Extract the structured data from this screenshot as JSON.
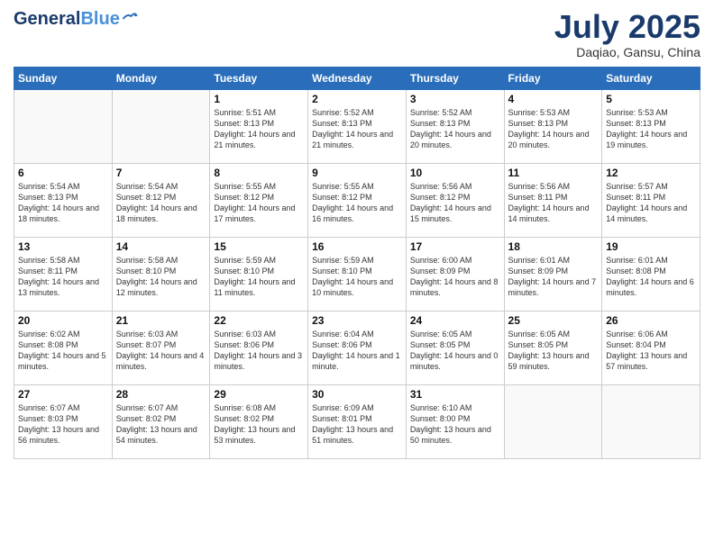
{
  "header": {
    "logo_line1": "General",
    "logo_line2": "Blue",
    "month_title": "July 2025",
    "subtitle": "Daqiao, Gansu, China"
  },
  "weekdays": [
    "Sunday",
    "Monday",
    "Tuesday",
    "Wednesday",
    "Thursday",
    "Friday",
    "Saturday"
  ],
  "weeks": [
    [
      {
        "day": "",
        "info": ""
      },
      {
        "day": "",
        "info": ""
      },
      {
        "day": "1",
        "info": "Sunrise: 5:51 AM\nSunset: 8:13 PM\nDaylight: 14 hours and 21 minutes."
      },
      {
        "day": "2",
        "info": "Sunrise: 5:52 AM\nSunset: 8:13 PM\nDaylight: 14 hours and 21 minutes."
      },
      {
        "day": "3",
        "info": "Sunrise: 5:52 AM\nSunset: 8:13 PM\nDaylight: 14 hours and 20 minutes."
      },
      {
        "day": "4",
        "info": "Sunrise: 5:53 AM\nSunset: 8:13 PM\nDaylight: 14 hours and 20 minutes."
      },
      {
        "day": "5",
        "info": "Sunrise: 5:53 AM\nSunset: 8:13 PM\nDaylight: 14 hours and 19 minutes."
      }
    ],
    [
      {
        "day": "6",
        "info": "Sunrise: 5:54 AM\nSunset: 8:13 PM\nDaylight: 14 hours and 18 minutes."
      },
      {
        "day": "7",
        "info": "Sunrise: 5:54 AM\nSunset: 8:12 PM\nDaylight: 14 hours and 18 minutes."
      },
      {
        "day": "8",
        "info": "Sunrise: 5:55 AM\nSunset: 8:12 PM\nDaylight: 14 hours and 17 minutes."
      },
      {
        "day": "9",
        "info": "Sunrise: 5:55 AM\nSunset: 8:12 PM\nDaylight: 14 hours and 16 minutes."
      },
      {
        "day": "10",
        "info": "Sunrise: 5:56 AM\nSunset: 8:12 PM\nDaylight: 14 hours and 15 minutes."
      },
      {
        "day": "11",
        "info": "Sunrise: 5:56 AM\nSunset: 8:11 PM\nDaylight: 14 hours and 14 minutes."
      },
      {
        "day": "12",
        "info": "Sunrise: 5:57 AM\nSunset: 8:11 PM\nDaylight: 14 hours and 14 minutes."
      }
    ],
    [
      {
        "day": "13",
        "info": "Sunrise: 5:58 AM\nSunset: 8:11 PM\nDaylight: 14 hours and 13 minutes."
      },
      {
        "day": "14",
        "info": "Sunrise: 5:58 AM\nSunset: 8:10 PM\nDaylight: 14 hours and 12 minutes."
      },
      {
        "day": "15",
        "info": "Sunrise: 5:59 AM\nSunset: 8:10 PM\nDaylight: 14 hours and 11 minutes."
      },
      {
        "day": "16",
        "info": "Sunrise: 5:59 AM\nSunset: 8:10 PM\nDaylight: 14 hours and 10 minutes."
      },
      {
        "day": "17",
        "info": "Sunrise: 6:00 AM\nSunset: 8:09 PM\nDaylight: 14 hours and 8 minutes."
      },
      {
        "day": "18",
        "info": "Sunrise: 6:01 AM\nSunset: 8:09 PM\nDaylight: 14 hours and 7 minutes."
      },
      {
        "day": "19",
        "info": "Sunrise: 6:01 AM\nSunset: 8:08 PM\nDaylight: 14 hours and 6 minutes."
      }
    ],
    [
      {
        "day": "20",
        "info": "Sunrise: 6:02 AM\nSunset: 8:08 PM\nDaylight: 14 hours and 5 minutes."
      },
      {
        "day": "21",
        "info": "Sunrise: 6:03 AM\nSunset: 8:07 PM\nDaylight: 14 hours and 4 minutes."
      },
      {
        "day": "22",
        "info": "Sunrise: 6:03 AM\nSunset: 8:06 PM\nDaylight: 14 hours and 3 minutes."
      },
      {
        "day": "23",
        "info": "Sunrise: 6:04 AM\nSunset: 8:06 PM\nDaylight: 14 hours and 1 minute."
      },
      {
        "day": "24",
        "info": "Sunrise: 6:05 AM\nSunset: 8:05 PM\nDaylight: 14 hours and 0 minutes."
      },
      {
        "day": "25",
        "info": "Sunrise: 6:05 AM\nSunset: 8:05 PM\nDaylight: 13 hours and 59 minutes."
      },
      {
        "day": "26",
        "info": "Sunrise: 6:06 AM\nSunset: 8:04 PM\nDaylight: 13 hours and 57 minutes."
      }
    ],
    [
      {
        "day": "27",
        "info": "Sunrise: 6:07 AM\nSunset: 8:03 PM\nDaylight: 13 hours and 56 minutes."
      },
      {
        "day": "28",
        "info": "Sunrise: 6:07 AM\nSunset: 8:02 PM\nDaylight: 13 hours and 54 minutes."
      },
      {
        "day": "29",
        "info": "Sunrise: 6:08 AM\nSunset: 8:02 PM\nDaylight: 13 hours and 53 minutes."
      },
      {
        "day": "30",
        "info": "Sunrise: 6:09 AM\nSunset: 8:01 PM\nDaylight: 13 hours and 51 minutes."
      },
      {
        "day": "31",
        "info": "Sunrise: 6:10 AM\nSunset: 8:00 PM\nDaylight: 13 hours and 50 minutes."
      },
      {
        "day": "",
        "info": ""
      },
      {
        "day": "",
        "info": ""
      }
    ]
  ]
}
